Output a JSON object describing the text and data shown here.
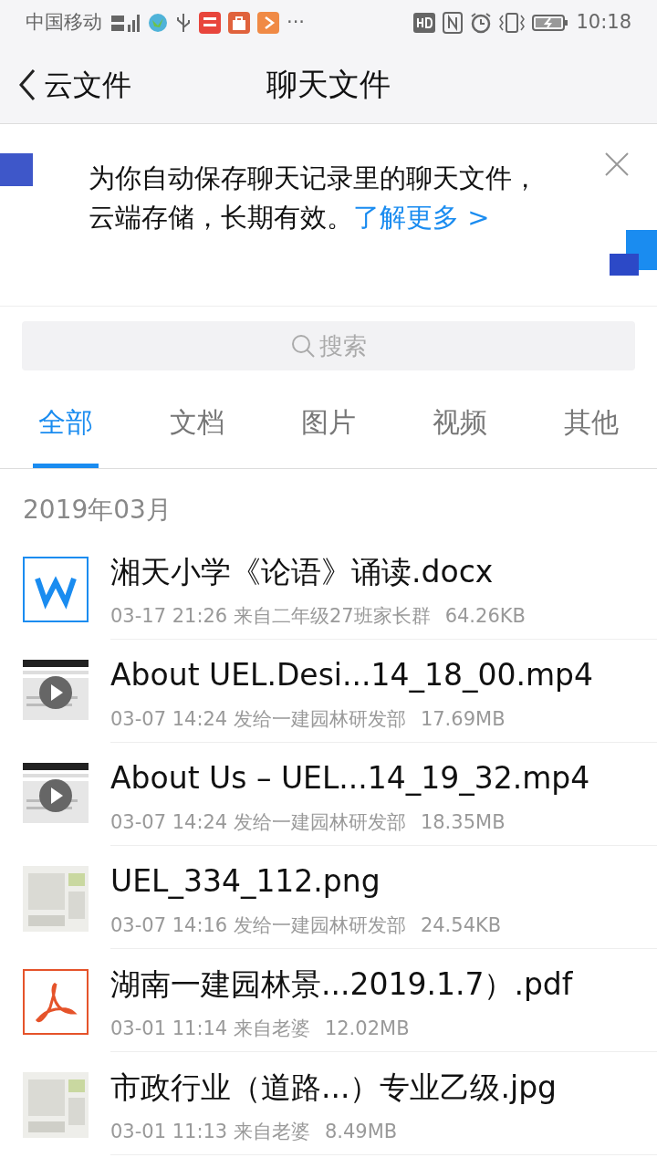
{
  "status_bar": {
    "carrier": "中国移动",
    "more": "···",
    "time": "10:18"
  },
  "header": {
    "back_label": "云文件",
    "title": "聊天文件"
  },
  "banner": {
    "text": "为你自动保存聊天记录里的聊天文件，云端存储，长期有效。",
    "link": "了解更多 >"
  },
  "search": {
    "placeholder": "搜索"
  },
  "tabs": [
    {
      "label": "全部",
      "selected": true
    },
    {
      "label": "文档",
      "selected": false
    },
    {
      "label": "图片",
      "selected": false
    },
    {
      "label": "视频",
      "selected": false
    },
    {
      "label": "其他",
      "selected": false
    }
  ],
  "section": "2019年03月",
  "files": [
    {
      "kind": "word",
      "name": "湘天小学《论语》诵读.docx",
      "time": "03-17 21:26",
      "source": "来自二年级27班家长群",
      "size": "64.26KB"
    },
    {
      "kind": "video",
      "name": "About UEL.Desi...14_18_00.mp4",
      "time": "03-07 14:24",
      "source": "发给一建园林研发部",
      "size": "17.69MB"
    },
    {
      "kind": "video",
      "name": "About Us – UEL...14_19_32.mp4",
      "time": "03-07 14:24",
      "source": "发给一建园林研发部",
      "size": "18.35MB"
    },
    {
      "name": "UEL_334_112.png",
      "time": "03-07 14:16",
      "source": "发给一建园林研发部",
      "size": "24.54KB"
    },
    {
      "kind": "pdf",
      "name": "湖南一建园林景...2019.1.7）.pdf",
      "time": "03-01 11:14",
      "source": "来自老婆",
      "size": "12.02MB"
    },
    {
      "name": "市政行业（道路...）专业乙级.jpg",
      "time": "03-01 11:13",
      "source": "来自老婆",
      "size": "8.49MB"
    }
  ]
}
